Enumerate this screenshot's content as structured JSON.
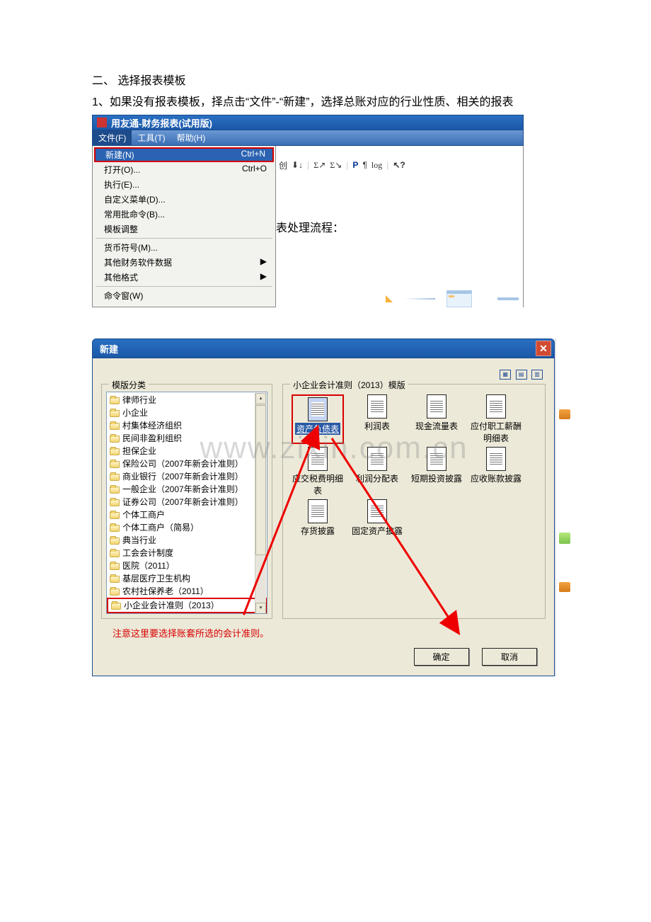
{
  "doc": {
    "heading": "二、    选择报表模板",
    "line1": "1、如果没有报表模板，择点击“文件”-“新建”，选择总账对应的行业性质、相关的报表"
  },
  "shot1": {
    "title": "用友通-财务报表(试用版)",
    "menubar": {
      "file": "文件(F)",
      "tools": "工具(T)",
      "help": "帮助(H)"
    },
    "menu": {
      "new": {
        "label": "新建(N)",
        "shortcut": "Ctrl+N"
      },
      "open": {
        "label": "打开(O)...",
        "shortcut": "Ctrl+O"
      },
      "run": "执行(E)...",
      "custom_menu": "自定义菜单(D)...",
      "batch": "常用批命令(B)...",
      "template_adjust": "模板调整",
      "currency": "货币符号(M)...",
      "other_finance": "其他财务软件数据",
      "other_format": "其他格式",
      "cmd_window": "命令窗(W)"
    },
    "toolbar": {
      "p": "P",
      "log": "log"
    },
    "flow_label": "表处理流程："
  },
  "shot2": {
    "title": "新建",
    "category_legend": "模版分类",
    "templates_legend": "小企业会计准则（2013）模版",
    "categories": [
      "律师行业",
      "小企业",
      "村集体经济组织",
      "民间非盈利组织",
      "担保企业",
      "保险公司（2007年新会计准则）",
      "商业银行（2007年新会计准则）",
      "一般企业（2007年新会计准则）",
      "证券公司（2007年新会计准则）",
      "个体工商户",
      "个体工商户（简易）",
      "典当行业",
      "工会会计制度",
      "医院（2011）",
      "基层医疗卫生机构",
      "农村社保养老（2011）",
      "小企业会计准则（2013）"
    ],
    "templates": [
      "资产负债表",
      "利润表",
      "现金流量表",
      "应付职工薪酬明细表",
      "应交税费明细表",
      "利润分配表",
      "短期投资披露",
      "应收账款披露",
      "存货披露",
      "固定资产披露"
    ],
    "note": "注意这里要选择账套所选的会计准则。",
    "ok": "确定",
    "cancel": "取消",
    "watermark": "www.zixin.com.cn"
  }
}
